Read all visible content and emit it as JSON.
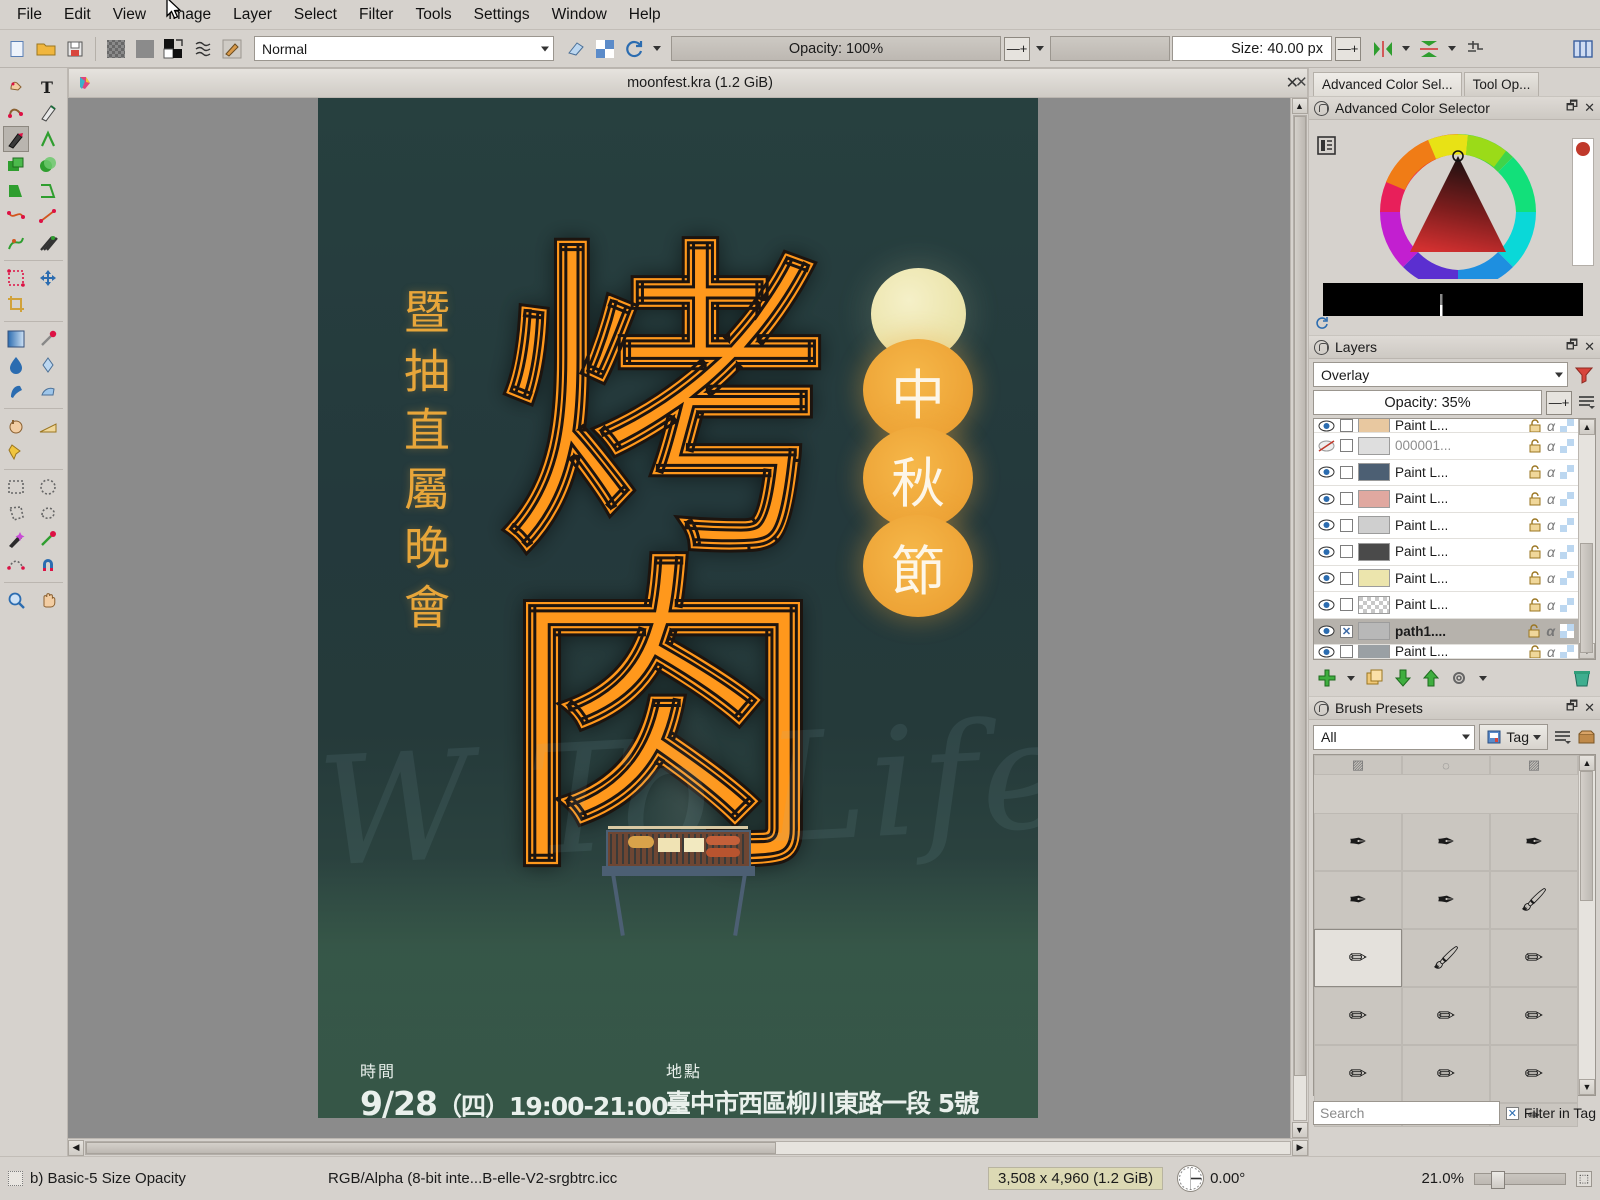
{
  "app": {
    "title": "Krita"
  },
  "menubar": {
    "items": [
      {
        "label": "File",
        "name": "menu-file"
      },
      {
        "label": "Edit",
        "name": "menu-edit"
      },
      {
        "label": "View",
        "name": "menu-view"
      },
      {
        "label": "Image",
        "name": "menu-image"
      },
      {
        "label": "Layer",
        "name": "menu-layer"
      },
      {
        "label": "Select",
        "name": "menu-select"
      },
      {
        "label": "Filter",
        "name": "menu-filter"
      },
      {
        "label": "Tools",
        "name": "menu-tools"
      },
      {
        "label": "Settings",
        "name": "menu-settings"
      },
      {
        "label": "Window",
        "name": "menu-window"
      },
      {
        "label": "Help",
        "name": "menu-help"
      }
    ]
  },
  "toolbar": {
    "blend_mode": "Normal",
    "opacity_label": "Opacity: 100%",
    "size_label": "Size: 40.00 px",
    "icons": [
      "new-document-icon",
      "open-document-icon",
      "save-icon",
      "undo-icon",
      "redo-icon",
      "fg-bg-color-icon",
      "gradient-list-icon",
      "brush-preset-icon"
    ],
    "right_icons": [
      "eraser-icon",
      "preserve-alpha-icon",
      "reload-preset-icon",
      "mirror-horizontal-icon",
      "mirror-vertical-icon",
      "wrap-around-icon",
      "workspace-icon"
    ]
  },
  "toolbox": {
    "tools": [
      {
        "name": "tool-shape-select",
        "glyph": "☞"
      },
      {
        "name": "tool-text",
        "glyph": "T"
      },
      {
        "name": "tool-edit-shapes",
        "glyph": "✎"
      },
      {
        "name": "tool-calligraphy",
        "glyph": "✒"
      },
      {
        "name": "tool-freehand-brush",
        "glyph": "🖌",
        "active": true
      },
      {
        "name": "tool-line",
        "glyph": "╱"
      },
      {
        "name": "tool-rectangle",
        "glyph": "▭"
      },
      {
        "name": "tool-ellipse",
        "glyph": "◯"
      },
      {
        "name": "tool-polygon",
        "glyph": "⬟"
      },
      {
        "name": "tool-polyline",
        "glyph": "⬠"
      },
      {
        "name": "tool-bezier-curve",
        "glyph": "∿"
      },
      {
        "name": "tool-freehand-path",
        "glyph": "⌇"
      },
      {
        "name": "tool-dynamic-brush",
        "glyph": "⁂"
      },
      {
        "name": "tool-transform",
        "glyph": "⬚"
      },
      {
        "name": "tool-move",
        "glyph": "✥"
      },
      {
        "name": "tool-crop",
        "glyph": "⌘"
      },
      {
        "name": "tool-gradient",
        "glyph": "■"
      },
      {
        "name": "tool-color-picker",
        "glyph": "💧"
      },
      {
        "name": "tool-fill",
        "glyph": "💧"
      },
      {
        "name": "tool-colorize-mask",
        "glyph": "❁"
      },
      {
        "name": "tool-smart-patch",
        "glyph": "⚗"
      },
      {
        "name": "tool-gradient-edit",
        "glyph": "◑"
      },
      {
        "name": "tool-multibrush",
        "glyph": "✋"
      },
      {
        "name": "tool-measure",
        "glyph": "◢"
      },
      {
        "name": "tool-reference-images",
        "glyph": "📌"
      },
      {
        "name": "tool-rect-select",
        "glyph": "⬚"
      },
      {
        "name": "tool-ellipse-select",
        "glyph": "◌"
      },
      {
        "name": "tool-polygon-select",
        "glyph": "⬡"
      },
      {
        "name": "tool-freehand-select",
        "glyph": "⎍"
      },
      {
        "name": "tool-contiguous-select",
        "glyph": "✨"
      },
      {
        "name": "tool-similar-select",
        "glyph": "❉"
      },
      {
        "name": "tool-bezier-select",
        "glyph": "◌"
      },
      {
        "name": "tool-magnetic-select",
        "glyph": "🧲"
      },
      {
        "name": "tool-zoom",
        "glyph": "🔍"
      },
      {
        "name": "tool-pan",
        "glyph": "✋"
      }
    ]
  },
  "document": {
    "tab_title": "moonfest.kra (1.2 GiB)",
    "close_label": "✕"
  },
  "poster": {
    "vertical_text": "暨抽直屬晚會",
    "big_character": "烤肉",
    "mooncake_chars": [
      "中",
      "秋",
      "節"
    ],
    "watermark": "W To Life",
    "time_label": "時間",
    "time_value": "9/28",
    "time_value_cjk": "（四）19:00-21:00",
    "place_label": "地點",
    "place_value": "臺中市西區柳川東路一段 5號"
  },
  "docks": {
    "tabs": [
      {
        "label": "Advanced Color Sel...",
        "name": "dock-tab-advanced-color-selector",
        "selected": true
      },
      {
        "label": "Tool Op...",
        "name": "dock-tab-tool-options",
        "selected": false
      }
    ],
    "color_selector": {
      "title": "Advanced Color Selector"
    },
    "layers": {
      "title": "Layers",
      "blend_mode": "Overlay",
      "opacity_label": "Opacity: 35%",
      "rows": [
        {
          "name": "Paint L...",
          "visible": true,
          "selected": false,
          "dim": false,
          "checked": false,
          "thumb": "#e8c8a0"
        },
        {
          "name": "000001...",
          "visible": false,
          "selected": false,
          "dim": true,
          "checked": false,
          "thumb": "#dedede"
        },
        {
          "name": "Paint L...",
          "visible": true,
          "selected": false,
          "dim": false,
          "checked": false,
          "thumb": "#4c5f73"
        },
        {
          "name": "Paint L...",
          "visible": true,
          "selected": false,
          "dim": false,
          "checked": false,
          "thumb": "#e0a8a0"
        },
        {
          "name": "Paint L...",
          "visible": true,
          "selected": false,
          "dim": false,
          "checked": false,
          "thumb": "#cfcfcf"
        },
        {
          "name": "Paint L...",
          "visible": true,
          "selected": false,
          "dim": false,
          "checked": false,
          "thumb": "#4a4a4a"
        },
        {
          "name": "Paint L...",
          "visible": true,
          "selected": false,
          "dim": false,
          "checked": false,
          "thumb": "#ece5ad"
        },
        {
          "name": "Paint L...",
          "visible": true,
          "selected": false,
          "dim": false,
          "checked": false,
          "thumb": "#ffffff"
        },
        {
          "name": "path1....",
          "visible": true,
          "selected": true,
          "dim": false,
          "checked": true,
          "thumb": "#b8b8b8"
        },
        {
          "name": "Paint L...",
          "visible": true,
          "selected": false,
          "dim": false,
          "checked": false,
          "thumb": "#9aa0a4"
        }
      ],
      "buttons": [
        {
          "name": "add-layer-button",
          "glyph": "✚"
        },
        {
          "name": "add-layer-dropdown",
          "glyph": "▾"
        },
        {
          "name": "duplicate-layer-button",
          "glyph": "🗀"
        },
        {
          "name": "move-layer-down-button",
          "glyph": "⬇"
        },
        {
          "name": "move-layer-up-button",
          "glyph": "⬆"
        },
        {
          "name": "layer-properties-button",
          "glyph": "⚙"
        },
        {
          "name": "layer-properties-dropdown",
          "glyph": "▾"
        },
        {
          "name": "delete-layer-button",
          "glyph": "🗑"
        }
      ]
    },
    "brush_presets": {
      "title": "Brush Presets",
      "filter_value": "All",
      "tag_label": "Tag",
      "search_placeholder": "Search",
      "filter_in_tag_label": "Filter in Tag",
      "cells": [
        {
          "name": "preset-chalk",
          "glyph": "▦",
          "selected": false
        },
        {
          "name": "preset-bristles",
          "glyph": "◌",
          "selected": false
        },
        {
          "name": "preset-noise",
          "glyph": "▦",
          "selected": false
        },
        {
          "name": "preset-airbrush-soft",
          "glyph": "✒",
          "selected": false
        },
        {
          "name": "preset-ink-gpen",
          "glyph": "✒",
          "selected": false
        },
        {
          "name": "preset-ink-tilt",
          "glyph": "✒",
          "selected": false
        },
        {
          "name": "preset-ink-fineliner",
          "glyph": "✒",
          "selected": false
        },
        {
          "name": "preset-ink-ballpen",
          "glyph": "✒",
          "selected": false
        },
        {
          "name": "preset-ink-brushpen",
          "glyph": "🖌",
          "selected": false
        },
        {
          "name": "preset-basic-5-size-opacity",
          "glyph": "✏",
          "selected": true
        },
        {
          "name": "preset-wet-brush",
          "glyph": "🖌",
          "selected": false
        },
        {
          "name": "preset-pencil-blue",
          "glyph": "✏",
          "selected": false
        },
        {
          "name": "preset-pencil-hatch",
          "glyph": "✏",
          "selected": false
        },
        {
          "name": "preset-pencil-2h",
          "glyph": "✏",
          "selected": false
        },
        {
          "name": "preset-pencil-dark",
          "glyph": "✏",
          "selected": false
        },
        {
          "name": "preset-pencil-tan",
          "glyph": "✏",
          "selected": false
        },
        {
          "name": "preset-pencil-grey",
          "glyph": "✏",
          "selected": false
        },
        {
          "name": "preset-marker-yellow",
          "glyph": "✏",
          "selected": false
        },
        {
          "name": "preset-green-marker",
          "glyph": "✏",
          "selected": false
        },
        {
          "name": "preset-blue-marker",
          "glyph": "✏",
          "selected": false
        },
        {
          "name": "preset-black-marker",
          "glyph": "✏",
          "selected": false
        }
      ]
    }
  },
  "statusbar": {
    "brush_preset": "b) Basic-5 Size Opacity",
    "color_profile": "RGB/Alpha (8-bit inte...B-elle-V2-srgbtrc.icc",
    "doc_size": "3,508 x 4,960 (1.2 GiB)",
    "rotation": "0.00°",
    "zoom": "21.0%"
  },
  "colors": {
    "accent_orange": "#f79a2e",
    "gold": "#e8a63a",
    "poster_bg": "#27403f",
    "chrome": "#d6d2cd"
  }
}
